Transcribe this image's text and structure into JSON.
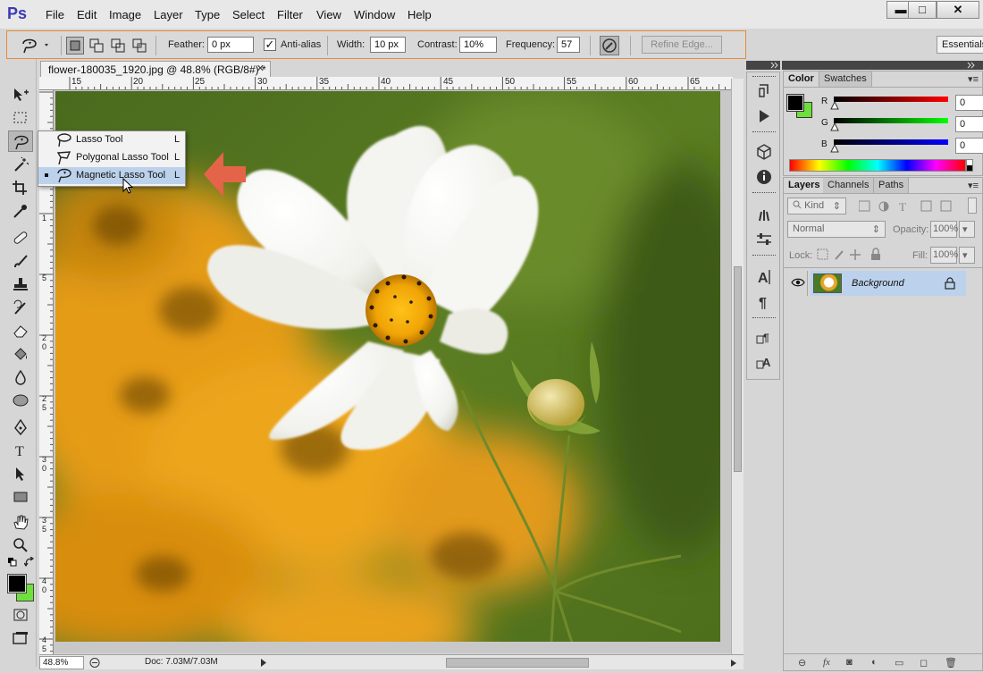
{
  "app": {
    "logo": "Ps",
    "menu": [
      "File",
      "Edit",
      "Image",
      "Layer",
      "Type",
      "Select",
      "Filter",
      "View",
      "Window",
      "Help"
    ],
    "window_buttons": {
      "minimize": "▬",
      "maximize": "□",
      "close": "✕"
    }
  },
  "options_bar": {
    "feather_label": "Feather:",
    "feather_value": "0 px",
    "antialias_label": "Anti-alias",
    "antialias_checked": "✓",
    "width_label": "Width:",
    "width_value": "10 px",
    "contrast_label": "Contrast:",
    "contrast_value": "10%",
    "frequency_label": "Frequency:",
    "frequency_value": "57",
    "refine_edge_label": "Refine Edge...",
    "workspace_label": "Essentials"
  },
  "document": {
    "tab_title": "flower-180035_1920.jpg @ 48.8% (RGB/8#) *",
    "tab_close": "✕",
    "ruler_top": [
      "15",
      "20",
      "25",
      "30",
      "35",
      "40",
      "45",
      "50",
      "55",
      "60",
      "65"
    ],
    "ruler_left": [
      "1",
      "5",
      "2\n0",
      "2\n5",
      "3\n0",
      "3\n5",
      "4\n0",
      "4\n5"
    ],
    "zoom": "48.8%",
    "doc_size": "Doc: 7.03M/7.03M"
  },
  "flyout": {
    "items": [
      {
        "label": "Lasso Tool",
        "key": "L"
      },
      {
        "label": "Polygonal Lasso Tool",
        "key": "L"
      },
      {
        "label": "Magnetic Lasso Tool",
        "key": "L"
      }
    ],
    "selected_index": 2
  },
  "color_panel": {
    "tabs": [
      "Color",
      "Swatches"
    ],
    "r_label": "R",
    "g_label": "G",
    "b_label": "B",
    "r_value": "0",
    "g_value": "0",
    "b_value": "0"
  },
  "layers_panel": {
    "tabs": [
      "Layers",
      "Channels",
      "Paths"
    ],
    "kind_label": "Kind",
    "blend_mode": "Normal",
    "opacity_label": "Opacity:",
    "opacity_value": "100%",
    "lock_label": "Lock:",
    "fill_label": "Fill:",
    "fill_value": "100%",
    "layers": [
      {
        "name": "Background",
        "visible": true,
        "locked": true
      }
    ]
  },
  "colors": {
    "foreground": "#000000",
    "background": "#6ee03c",
    "accent_orange": "#e68a3a",
    "selection_blue": "#bcd2ec"
  }
}
